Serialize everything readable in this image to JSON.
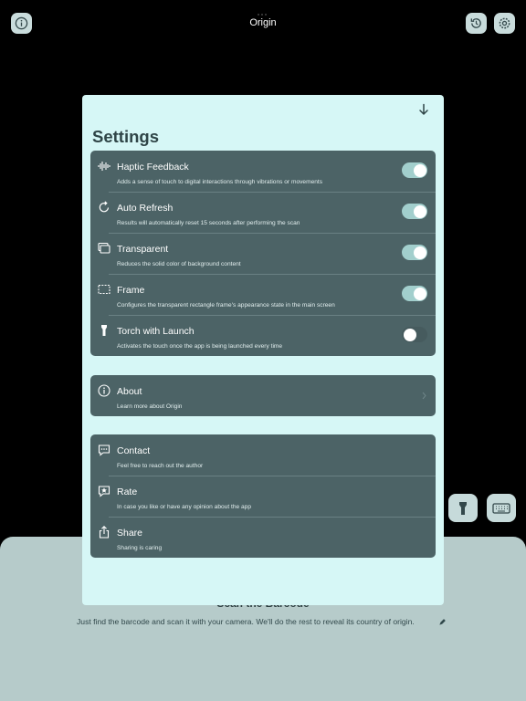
{
  "app": {
    "title": "Origin"
  },
  "topbar": {
    "left_icon": "info-icon",
    "right_icons": [
      "history-icon",
      "gear-icon"
    ]
  },
  "background": {
    "heading": "Scan the Barcode",
    "hint": "Just find the barcode and scan it with your camera. We'll do the rest to reveal its country of origin.",
    "buttons": [
      "flashlight-icon",
      "keyboard-icon"
    ]
  },
  "settings": {
    "title": "Settings",
    "dismiss_icon": "arrow-down-icon",
    "toggles": [
      {
        "label": "Haptic Feedback",
        "subtitle": "Adds a sense of touch to digital interactions through vibrations or movements",
        "icon": "waveform-icon",
        "on": true
      },
      {
        "label": "Auto Refresh",
        "subtitle": "Results will automatically reset 15 seconds after performing the scan",
        "icon": "refresh-icon",
        "on": true
      },
      {
        "label": "Transparent",
        "subtitle": "Reduces the solid color of background content",
        "icon": "windows-icon",
        "on": true
      },
      {
        "label": "Frame",
        "subtitle": "Configures the transparent rectangle frame's appearance state in the main screen",
        "icon": "dashed-frame-icon",
        "on": true
      },
      {
        "label": "Torch with Launch",
        "subtitle": "Activates the touch once the app is being launched every time",
        "icon": "torch-icon",
        "on": false
      }
    ],
    "about": {
      "label": "About",
      "subtitle": "Learn more about Origin",
      "icon": "info-icon"
    },
    "links": [
      {
        "label": "Contact",
        "subtitle": "Feel free to reach out the author",
        "icon": "message-icon"
      },
      {
        "label": "Rate",
        "subtitle": "In case you like or have any opinion about the app",
        "icon": "star-bubble-icon"
      },
      {
        "label": "Share",
        "subtitle": "Sharing is caring",
        "icon": "share-icon"
      }
    ]
  },
  "colors": {
    "sheet": "#d6f7f6",
    "group": "#4c6366",
    "toggle_on": "#a2cfcd",
    "bottom_panel": "#b6cbca"
  }
}
